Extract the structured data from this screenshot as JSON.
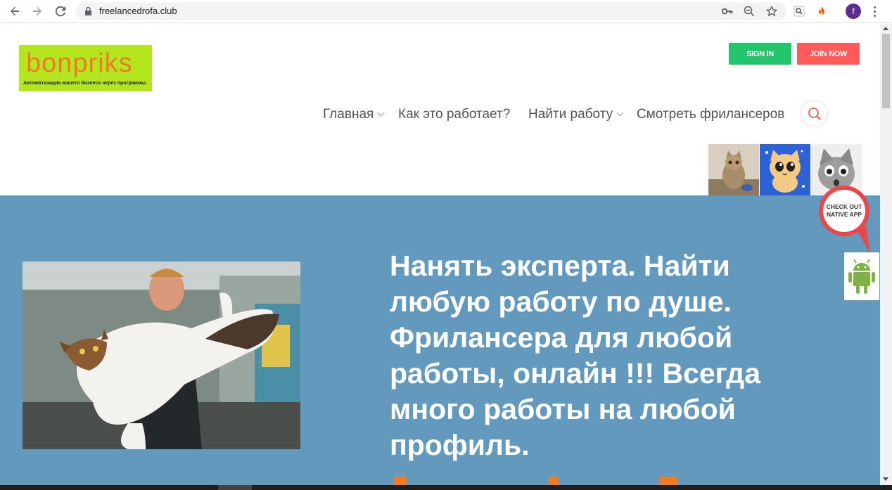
{
  "browser": {
    "url": "freelancedrofa.club",
    "profile_initial": "f"
  },
  "header": {
    "logo_text": "bonpriks",
    "logo_tagline": "Автоматизация вашего бизнеса через программы.",
    "sign_in_label": "SIGN IN",
    "join_label": "JOIN NOW"
  },
  "menu": {
    "items": [
      {
        "label": "Главная",
        "has_dropdown": true
      },
      {
        "label": "Как это работает?",
        "has_dropdown": false
      },
      {
        "label": "Найти работу",
        "has_dropdown": true
      },
      {
        "label": "Смотреть фрилансеров",
        "has_dropdown": false
      }
    ]
  },
  "badge": {
    "line1": "CHECK OUT",
    "line2": "NATIVE APP"
  },
  "hero": {
    "headline_lines": [
      "Нанять эксперта. Найти",
      "любую работу по душе.",
      "Фрилансера для любой",
      "работы, онлайн !!! Всегда",
      "много работы на любой",
      "профиль."
    ]
  },
  "colors": {
    "hero_bg": "#6399bd",
    "sign_in": "#22c56b",
    "join": "#ff5a5a",
    "logo_bg": "#b4e620",
    "logo_text": "#f07c22",
    "accent_red": "#e9474a"
  },
  "icons": [
    "back-arrow-icon",
    "forward-arrow-icon",
    "reload-icon",
    "lock-icon",
    "key-icon",
    "zoom-icon",
    "star-icon",
    "search-icon",
    "android-icon",
    "chevron-down-icon"
  ]
}
